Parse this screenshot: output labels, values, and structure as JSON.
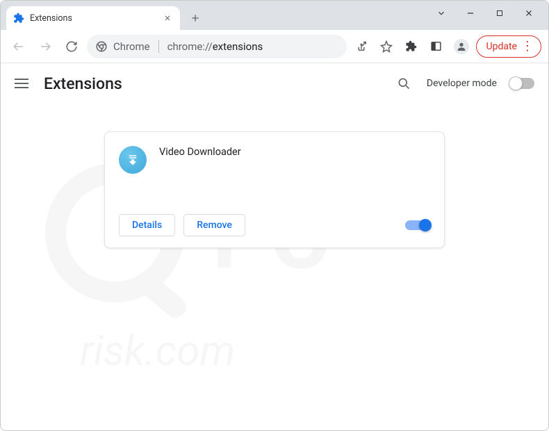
{
  "tab": {
    "title": "Extensions"
  },
  "address": {
    "app": "Chrome",
    "prefix": "chrome://",
    "path": "extensions"
  },
  "toolbar": {
    "update_label": "Update"
  },
  "page_header": {
    "title": "Extensions",
    "dev_mode_label": "Developer mode",
    "dev_mode_on": false
  },
  "extension": {
    "name": "Video Downloader",
    "details_label": "Details",
    "remove_label": "Remove",
    "enabled": true
  },
  "watermark": "PCrisk.com"
}
